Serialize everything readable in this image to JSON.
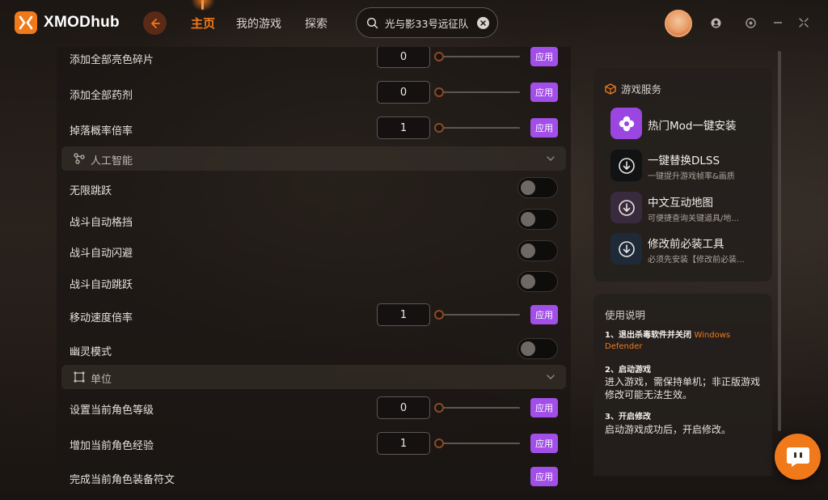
{
  "app": {
    "name": "XMODhub",
    "accent": "#f07a1a",
    "apply_color": "#a24ee8"
  },
  "nav": [
    {
      "label": "主页",
      "active": true
    },
    {
      "label": "我的游戏",
      "active": false
    },
    {
      "label": "探索",
      "active": false
    }
  ],
  "search": {
    "value": "光与影33号远征队",
    "placeholder": ""
  },
  "window_controls": [
    "support-icon",
    "settings-icon",
    "minimize-icon",
    "collapse-icon"
  ],
  "rows_top": [
    {
      "label": "添加全部亮色碎片",
      "value": "0",
      "apply": "应用"
    },
    {
      "label": "添加全部药剂",
      "value": "0",
      "apply": "应用"
    },
    {
      "label": "掉落概率倍率",
      "value": "1",
      "apply": "应用"
    }
  ],
  "section_ai": {
    "title": "人工智能",
    "toggles": [
      "无限跳跃",
      "战斗自动格挡",
      "战斗自动闪避",
      "战斗自动跳跃"
    ],
    "speed": {
      "label": "移动速度倍率",
      "value": "1",
      "apply": "应用"
    },
    "ghost": "幽灵模式"
  },
  "section_unit": {
    "title": "单位",
    "rows": [
      {
        "label": "设置当前角色等级",
        "value": "0",
        "apply": "应用"
      },
      {
        "label": "增加当前角色经验",
        "value": "1",
        "apply": "应用"
      }
    ],
    "equip": {
      "label": "完成当前角色装备符文",
      "apply": "应用"
    }
  },
  "services": {
    "title": "游戏服务",
    "items": [
      {
        "name": "热门Mod一键安装",
        "sub": ""
      },
      {
        "name": "一键替换DLSS",
        "sub": "一键提升游戏帧率&画质"
      },
      {
        "name": "中文互动地图",
        "sub": "可便捷查询关键道具/地..."
      },
      {
        "name": "修改前必装工具",
        "sub": "必须先安装【修改前必装..."
      }
    ]
  },
  "usage": {
    "title": "使用说明",
    "step1_title": "1、退出杀毒软件并关闭",
    "step1_accent": "Windows Defender",
    "step2_title": "2、启动游戏",
    "step2_body": "进入游戏，需保持单机；非正版游戏修改可能无法生效。",
    "step3_title": "3、开启修改",
    "step3_body": "启动游戏成功后，开启修改。"
  }
}
